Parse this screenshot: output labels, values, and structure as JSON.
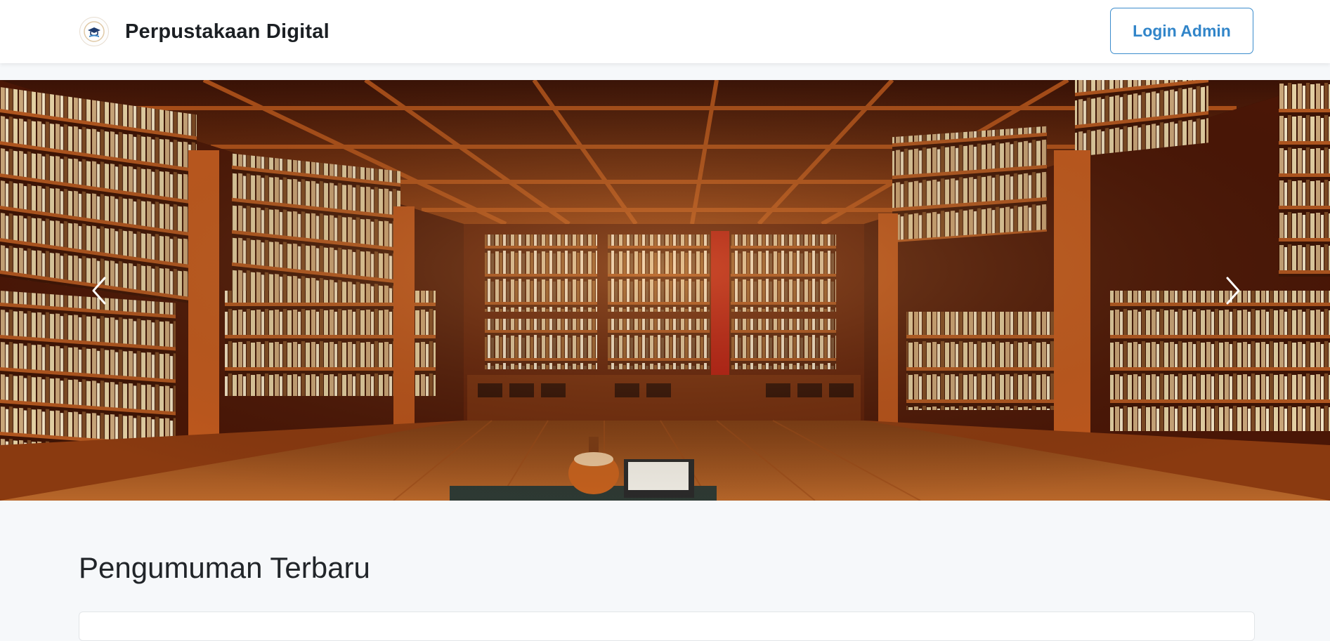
{
  "navbar": {
    "brand_name": "Perpustakaan Digital",
    "logo_icon": "graduation-cap-book-logo",
    "login_label": "Login Admin"
  },
  "hero_carousel": {
    "image_subject": "library-bookshelves-interior",
    "prev_icon": "chevron-left-icon",
    "next_icon": "chevron-right-icon"
  },
  "announcements": {
    "heading": "Pengumuman Terbaru"
  },
  "colors": {
    "primary": "#3185c9",
    "page_background": "#f6f8fa",
    "navbar_background": "#ffffff",
    "heading_text": "#212529"
  }
}
